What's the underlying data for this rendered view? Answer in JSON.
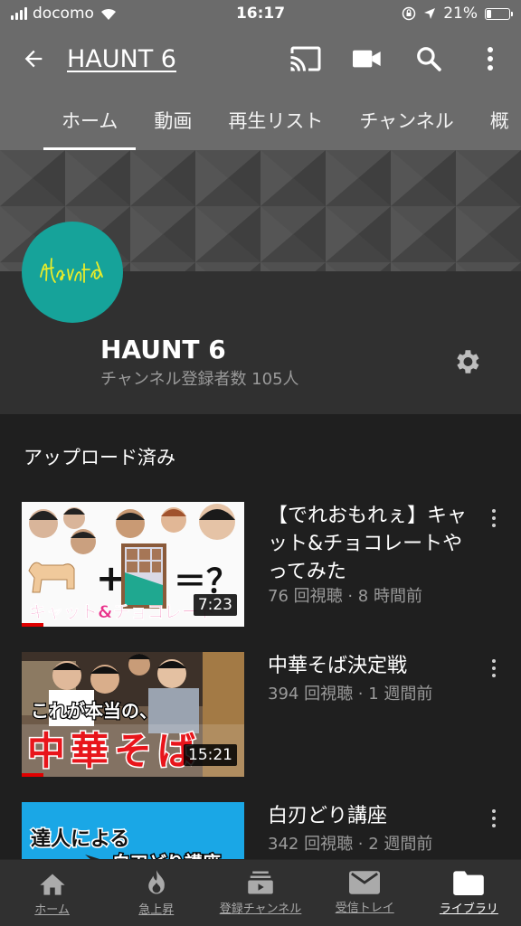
{
  "status_bar": {
    "carrier": "docomo",
    "time": "16:17",
    "battery_percent": "21%",
    "battery_level": 0.21
  },
  "app_bar": {
    "title": "HAUNT 6",
    "icons": [
      "back-arrow-icon",
      "cast-icon",
      "video-camera-icon",
      "search-icon",
      "more-vert-icon"
    ]
  },
  "tabs": [
    "ホーム",
    "動画",
    "再生リスト",
    "チャンネル",
    "概"
  ],
  "channel": {
    "name": "HAUNT 6",
    "subscribers": "チャンネル登録者数 105人",
    "avatar_color": "#16a39a"
  },
  "uploads": {
    "section_title": "アップロード済み",
    "videos": [
      {
        "title": "【でれおもれぇ】キャット&チョコレートやってみた",
        "meta": "76 回視聴 · 8 時間前",
        "duration": "7:23",
        "thumb_caption": "キャット&チョコレート",
        "thumb_formula": "+ ＝？",
        "watched_fraction": 0.1
      },
      {
        "title": "中華そば決定戦",
        "meta": "394 回視聴 · 1 週間前",
        "duration": "15:21",
        "thumb_caption_top": "これが本当の、",
        "thumb_caption_big": "中華そば",
        "watched_fraction": 0.1
      },
      {
        "title": "白刃どり講座",
        "meta": "342 回視聴 · 2 週間前",
        "thumb_caption_top": "達人による",
        "thumb_caption_bottom": "白刃どり講座"
      }
    ]
  },
  "bottom_nav": [
    {
      "label": "ホーム",
      "icon": "home-icon"
    },
    {
      "label": "急上昇",
      "icon": "flame-icon"
    },
    {
      "label": "登録チャンネル",
      "icon": "subscriptions-icon"
    },
    {
      "label": "受信トレイ",
      "icon": "mail-icon"
    },
    {
      "label": "ライブラリ",
      "icon": "folder-icon"
    }
  ],
  "colors": {
    "header_bg": "#6b6b6b",
    "content_bg": "#1f1f1f",
    "card_bg": "#303030",
    "progress_red": "#e00000"
  }
}
